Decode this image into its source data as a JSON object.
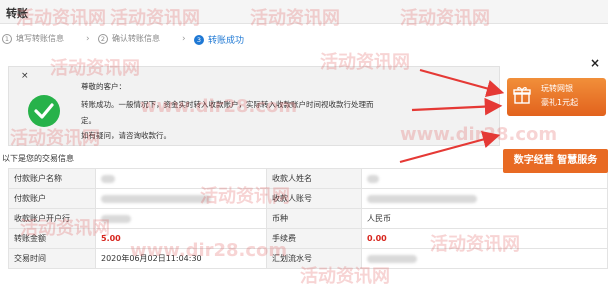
{
  "header": {
    "title": "转账"
  },
  "steps": [
    {
      "num": "1",
      "label": "填写转账信息"
    },
    {
      "num": "2",
      "label": "确认转账信息"
    },
    {
      "num": "3",
      "label": "转账成功"
    }
  ],
  "success": {
    "close": "×",
    "greeting": "尊敬的客户：",
    "message_line1": "转账成功。一般情况下，资金实时转入收款账户，实际转入收款账户时间视收款行处理而",
    "message_line2": "定。",
    "message_line3": "如有疑问，请咨询收款行。"
  },
  "info_title": "以下是您的交易信息",
  "table": {
    "rows": [
      {
        "k1": "付款账户名称",
        "v1": "",
        "k2": "收款人姓名",
        "v2": ""
      },
      {
        "k1": "付款账户",
        "v1": "",
        "k2": "收款人账号",
        "v2": ""
      },
      {
        "k1": "收款账户开户行",
        "v1": "",
        "k2": "币种",
        "v2": "人民币"
      },
      {
        "k1": "转账金额",
        "v1": "5.00",
        "k2": "手续费",
        "v2": "0.00"
      },
      {
        "k1": "交易时间",
        "v1": "2020年06月02日11:04:30",
        "k2": "汇划流水号",
        "v2": ""
      }
    ]
  },
  "ad": {
    "close": "×",
    "gift_line1": "玩转网银",
    "gift_line2": "豪礼1元起",
    "service": "数字经营 智慧服务"
  },
  "watermarks": [
    "活动资讯网",
    "www.dir28.com"
  ],
  "colors": {
    "accent": "#1e78d4",
    "success": "#27b24a",
    "amount_red": "#d7261e",
    "ad_orange": "#e86a23",
    "arrow_red": "#e53935"
  }
}
